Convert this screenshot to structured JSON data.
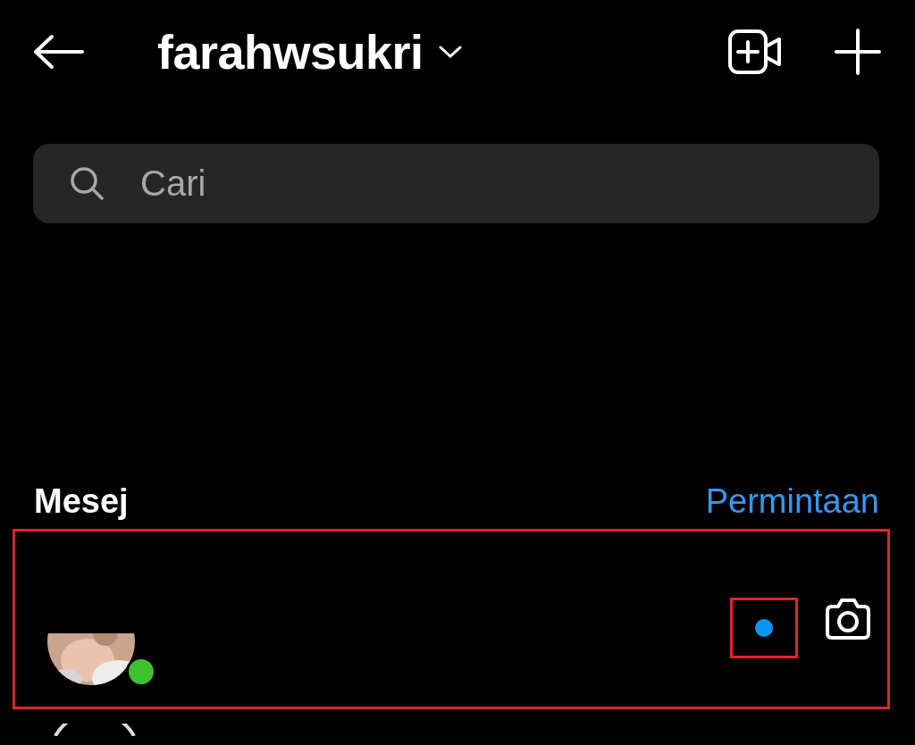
{
  "header": {
    "username": "farahwsukri"
  },
  "search": {
    "placeholder": "Cari"
  },
  "messages": {
    "title": "Mesej",
    "requests_link": "Permintaan"
  },
  "conversations": [
    {
      "kind": "picture",
      "online": true,
      "unread": true,
      "highlighted": true,
      "unread_highlighted": true
    },
    {
      "kind": "outline"
    }
  ]
}
